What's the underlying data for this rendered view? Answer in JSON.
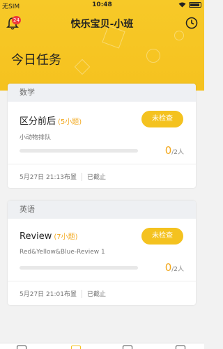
{
  "status": {
    "carrier": "无SIM",
    "time": "10:48"
  },
  "header": {
    "badge": "24",
    "title": "快乐宝贝-小班",
    "heading": "今日任务"
  },
  "cards": [
    {
      "subject": "数学",
      "title": "区分前后",
      "count": "(5小题)",
      "subtitle": "小动物排队",
      "button": "未检查",
      "done_num": "0",
      "done_total": "/2人",
      "date": "5月27日 21:13布置",
      "status": "已截止"
    },
    {
      "subject": "英语",
      "title": "Review",
      "count": "(7小题)",
      "subtitle": "Red&Yellow&Blue-Review 1",
      "button": "未检查",
      "done_num": "0",
      "done_total": "/2人",
      "date": "5月27日 21:01布置",
      "status": "已截止"
    }
  ],
  "colors": {
    "accent": "#f5c21f",
    "badge": "#ef3b3b",
    "count": "#f2a81d"
  }
}
